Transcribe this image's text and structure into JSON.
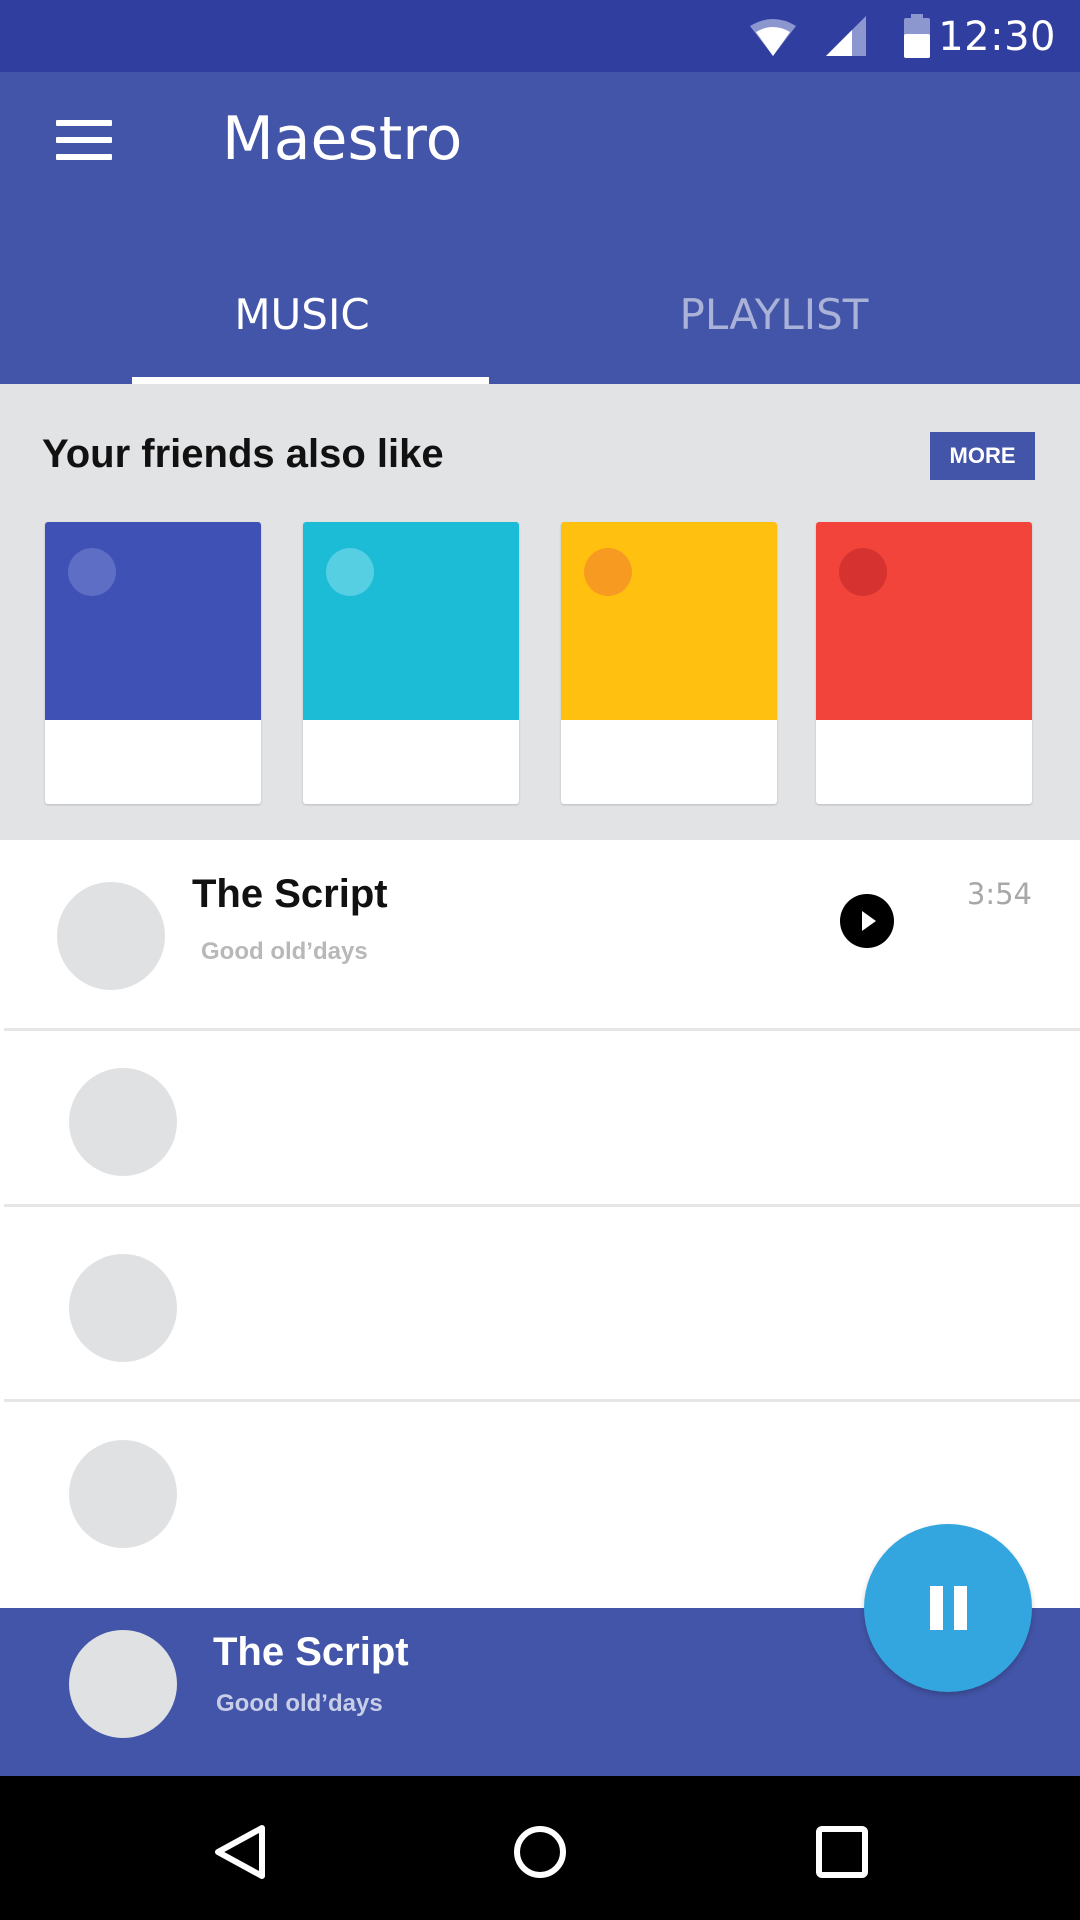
{
  "status_bar": {
    "time": "12:30",
    "icons": [
      "wifi-icon",
      "signal-icon",
      "battery-icon"
    ]
  },
  "app_bar": {
    "title": "Maestro",
    "menu_icon": "menu-icon",
    "tabs": [
      {
        "label": "MUSIC",
        "selected": true
      },
      {
        "label": "PLAYLIST",
        "selected": false
      }
    ]
  },
  "friends": {
    "heading": "Your friends also like",
    "more_label": "MORE",
    "cards": [
      {
        "color": "#3f51b5",
        "dot_color": "#5d6ec4"
      },
      {
        "color": "#1cbcd6",
        "dot_color": "#56cfe2"
      },
      {
        "color": "#ffc010",
        "dot_color": "#f79a22"
      },
      {
        "color": "#f2443a",
        "dot_color": "#d63230"
      }
    ]
  },
  "track_list": {
    "items": [
      {
        "title": "The Script",
        "subtitle": "Good old’days",
        "duration": "3:54",
        "action_icon": "play-icon"
      },
      {
        "title": "",
        "subtitle": "",
        "duration": ""
      },
      {
        "title": "",
        "subtitle": "",
        "duration": ""
      },
      {
        "title": "",
        "subtitle": "",
        "duration": ""
      }
    ]
  },
  "now_playing": {
    "title": "The Script",
    "subtitle": "Good old’days",
    "fab_icon": "pause-icon"
  },
  "nav_bar": {
    "buttons": [
      "back-icon",
      "home-icon",
      "recents-icon"
    ]
  },
  "colors": {
    "status_bar": "#303f9f",
    "primary": "#4355a8",
    "accent": "#34a6df",
    "section_bg": "#e2e3e5"
  }
}
